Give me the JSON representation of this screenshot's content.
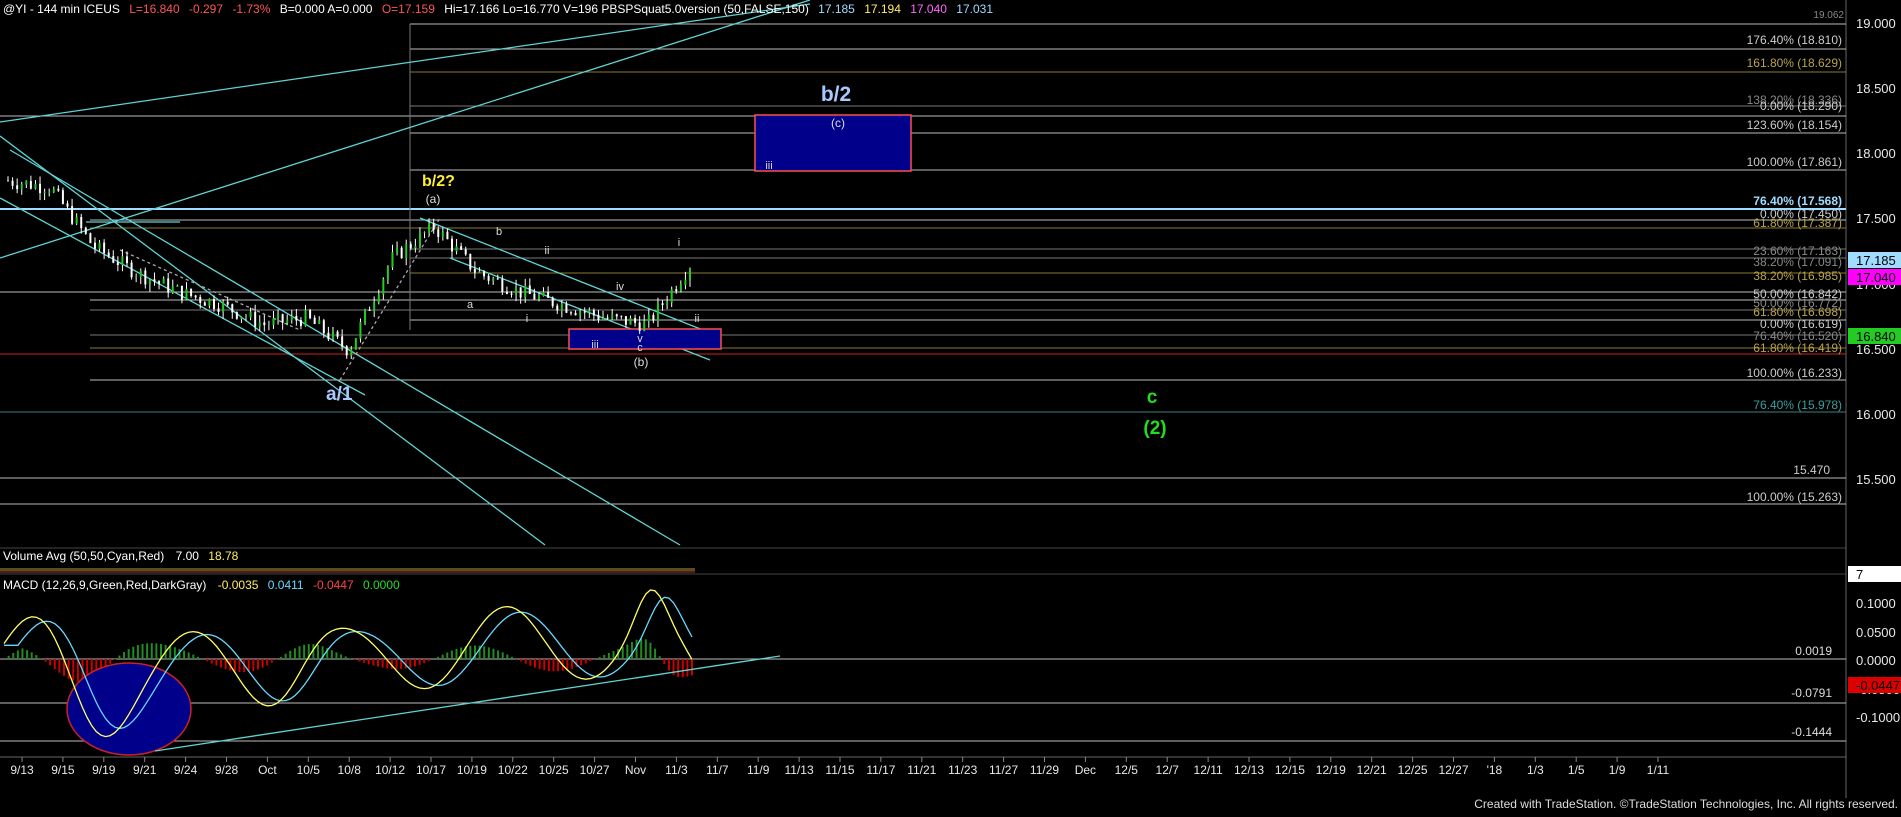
{
  "header": {
    "symbol": "@YI - 144 min  ICEUS",
    "last": "L=16.840",
    "change": "-0.297",
    "change_pct": "-1.73%",
    "bid_ask": "B=0.000  A=0.000",
    "open": "O=17.159",
    "hi_lo_vol": "Hi=17.166  Lo=16.770  V=196  PBSPSquat5.0version (50,FALSE,150)",
    "ind1": "17.185",
    "ind2": "17.194",
    "ind3": "17.040",
    "ind4": "17.031"
  },
  "price_axis": {
    "ticks": [
      "19.000",
      "18.500",
      "18.000",
      "17.500",
      "17.000",
      "16.500",
      "16.000",
      "15.500"
    ],
    "badges": [
      {
        "text": "17.185",
        "bg": "#9fdcff",
        "fg": "#000000"
      },
      {
        "text": "17.040",
        "bg": "#ff00ff",
        "fg": "#000000"
      },
      {
        "text": "16.840",
        "bg": "#22cc22",
        "fg": "#000000"
      }
    ]
  },
  "fib_labels": {
    "f1": "176.40% (18.810)",
    "f2": "161.80% (18.629)",
    "f3": "138.20% (18.336)",
    "f4": "0.00% (18.290)",
    "f5": "123.60% (18.154)",
    "f6": "100.00% (17.861)",
    "f7": "76.40% (17.568)",
    "f8": "0.00% (17.450)",
    "f9": "61.80% (17.387)",
    "f10": "23.60% (17.163)",
    "f11": "38.20% (17.091)",
    "f12": "38.20% (16.985)",
    "f13": "50.00% (16.842)",
    "f14": "50.00% (16.772)",
    "f15": "61.80% (16.698)",
    "f16": "0.00% (16.619)",
    "f17": "76.40% (16.520)",
    "f18": "61.80% (16.419)",
    "f19": "100.00% (16.233)",
    "f20": "76.40% (15.978)",
    "f21": "15.470",
    "f22": "100.00% (15.263)"
  },
  "wave_labels": {
    "b2": "b/2",
    "b2q": "b/2?",
    "a1": "a/1",
    "c": "c",
    "paren2": "(2)",
    "a_paren": "(a)",
    "c_paren": "(c)",
    "b_paren": "(b)",
    "iii_box": "iii",
    "small_b": "b",
    "small_a": "a",
    "small_ii": "ii",
    "small_i": "i",
    "small_iv": "iv",
    "small_v": "v",
    "small_iii": "iii",
    "small_c": "c",
    "small_i2": "i",
    "small_ii2": "ii"
  },
  "volume": {
    "label": "Volume Avg (50,50,Cyan,Red)",
    "v1": "7.00",
    "v2": "18.78",
    "axis_badge": "7"
  },
  "macd": {
    "label": "MACD (12,26,9,Green,Red,DarkGray)",
    "v1": "-0.0035",
    "v2": "0.0411",
    "v3": "-0.0447",
    "v4": "0.0000",
    "ticks": [
      "0.1000",
      "0.0500",
      "0.0000",
      "-0.0500",
      "-0.1000"
    ],
    "badge": "-0.0447",
    "level1": "0.0019",
    "level2": "-0.0791",
    "level3": "-0.1444"
  },
  "x_axis": {
    "dates": [
      "9/13",
      "9/15",
      "9/19",
      "9/21",
      "9/24",
      "9/28",
      "Oct",
      "10/5",
      "10/8",
      "10/12",
      "10/17",
      "10/19",
      "10/22",
      "10/25",
      "10/27",
      "Nov",
      "11/3",
      "11/7",
      "11/9",
      "11/13",
      "11/15",
      "11/17",
      "11/21",
      "11/23",
      "11/27",
      "11/29",
      "Dec",
      "12/5",
      "12/7",
      "12/11",
      "12/13",
      "12/15",
      "12/19",
      "12/21",
      "12/25",
      "12/27",
      "'18",
      "1/3",
      "1/5",
      "1/9",
      "1/11"
    ]
  },
  "footer": "Created with TradeStation. ©TradeStation Technologies, Inc. All rights reserved.",
  "colors": {
    "background": "#000000",
    "candles": "#ffffff",
    "trend_channel": "#5fd3d3",
    "fib_line": "#ffffff",
    "box_fill": "#00008b",
    "box_border": "#ff4d4d",
    "macd_hist_pos": "#228b22",
    "macd_hist_neg": "#cc0000",
    "macd_line": "#ffff66",
    "signal_line": "#66d9ff",
    "wave_green": "#22dd22",
    "wave_blue": "#a8c8ff",
    "wave_yellow": "#ffee33"
  },
  "chart_data": {
    "type": "line",
    "title": "@YI - 144 min ICEUS",
    "xlabel": "",
    "ylabel": "",
    "ylim": [
      15.0,
      19.1
    ],
    "x": [
      "9/13",
      "9/15",
      "9/19",
      "9/21",
      "9/24",
      "9/28",
      "Oct",
      "10/5",
      "10/8",
      "10/12",
      "10/17",
      "10/19",
      "10/22",
      "10/25",
      "10/27",
      "Nov",
      "11/3"
    ],
    "series": [
      {
        "values": [
          17.8,
          17.75,
          17.3,
          17.1,
          16.95,
          16.85,
          16.7,
          16.75,
          16.5,
          17.2,
          17.45,
          17.1,
          16.95,
          16.85,
          16.75,
          16.7,
          17.15
        ]
      }
    ],
    "levels": [
      18.81,
      18.629,
      18.336,
      18.29,
      18.154,
      17.861,
      17.568,
      17.45,
      17.387,
      17.163,
      17.091,
      16.985,
      16.842,
      16.772,
      16.698,
      16.619,
      16.52,
      16.419,
      16.233,
      15.978,
      15.47,
      15.263
    ],
    "macd_levels": [
      0.0019,
      -0.0791,
      -0.1444
    ]
  }
}
